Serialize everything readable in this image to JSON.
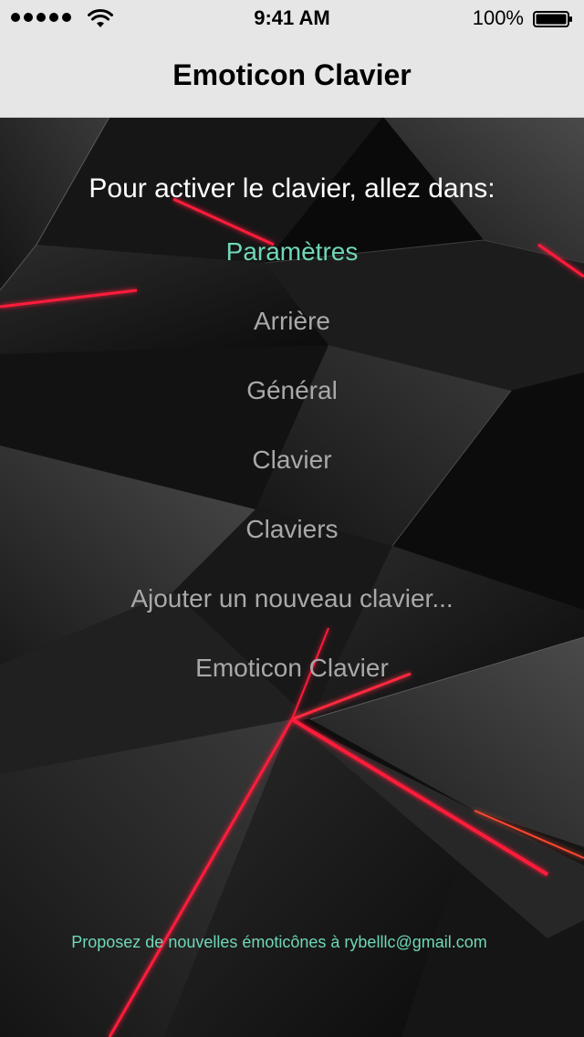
{
  "status_bar": {
    "time": "9:41 AM",
    "battery_percent": "100%",
    "signal_bars": 5,
    "icons": [
      "signal-dots-icon",
      "wifi-icon",
      "battery-icon"
    ]
  },
  "nav": {
    "title": "Emoticon Clavier"
  },
  "main": {
    "heading": "Pour activer le clavier, allez dans:",
    "steps": [
      "Paramètres",
      "Arrière",
      "Général",
      "Clavier",
      "Claviers",
      "Ajouter un nouveau clavier...",
      "Emoticon Clavier"
    ],
    "footer": "Proposez de nouvelles émoticônes à rybelllc@gmail.com"
  },
  "colors": {
    "accent": "#6fd7b8",
    "step_text": "#a9a9a9",
    "nav_background": "#e6e6e6",
    "background": "#111111",
    "highlight_red": "#ff1a3a"
  }
}
